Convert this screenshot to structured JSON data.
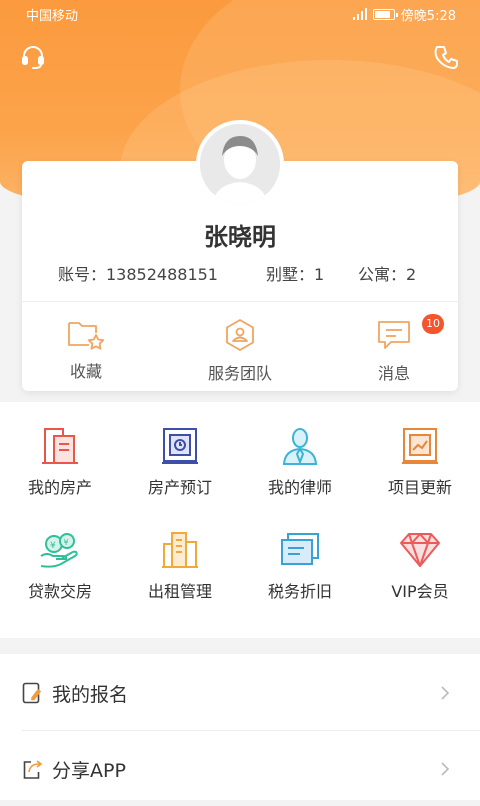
{
  "status_bar": {
    "carrier": "中国移动",
    "time": "傍晚5:28"
  },
  "header": {
    "left_icon": "headset-icon",
    "right_icon": "phone-icon"
  },
  "profile": {
    "name": "张晓明",
    "account": "账号：13852488151",
    "villa": "别墅：1",
    "apartment": "公寓：2"
  },
  "quick_actions": [
    {
      "label": "收藏",
      "icon": "folder-star-icon"
    },
    {
      "label": "服务团队",
      "icon": "team-badge-icon"
    },
    {
      "label": "消息",
      "icon": "message-icon",
      "badge": "10"
    }
  ],
  "grid": [
    {
      "label": "我的房产",
      "icon": "building-icon",
      "color": "#e8574a"
    },
    {
      "label": "房产预订",
      "icon": "calendar-frame-icon",
      "color": "#3d4fa8"
    },
    {
      "label": "我的律师",
      "icon": "lawyer-icon",
      "color": "#3bb4d8"
    },
    {
      "label": "项目更新",
      "icon": "chart-board-icon",
      "color": "#e8873a"
    },
    {
      "label": "贷款交房",
      "icon": "money-bag-icon",
      "color": "#2fbf9a"
    },
    {
      "label": "出租管理",
      "icon": "rent-building-icon",
      "color": "#f0a93a"
    },
    {
      "label": "税务折旧",
      "icon": "monitor-icon",
      "color": "#3aa0d8"
    },
    {
      "label": "VIP会员",
      "icon": "diamond-icon",
      "color": "#ec5a5a"
    }
  ],
  "list": [
    {
      "label": "我的报名",
      "icon": "signup-icon"
    },
    {
      "label": "分享APP",
      "icon": "share-icon"
    }
  ]
}
